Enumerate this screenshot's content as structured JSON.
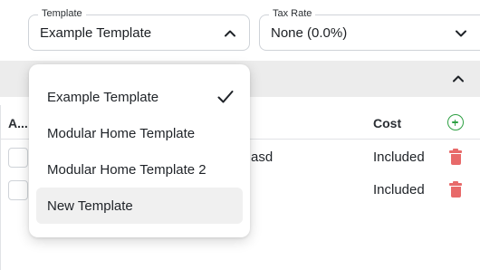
{
  "filters": {
    "template": {
      "label": "Template",
      "value": "Example Template",
      "icon": "chevron-up-icon"
    },
    "tax_rate": {
      "label": "Tax Rate",
      "value": "None (0.0%)",
      "icon": "chevron-down-icon"
    }
  },
  "section": {
    "icon": "chevron-up-icon"
  },
  "table": {
    "columns": {
      "a": "A...",
      "cost": "Cost"
    },
    "add_icon": "plus-circle-icon",
    "rows": [
      {
        "description": "asd",
        "cost": "Included"
      },
      {
        "description": "",
        "cost": "Included"
      }
    ]
  },
  "dropdown": {
    "items": [
      {
        "label": "Example Template",
        "selected": true
      },
      {
        "label": "Modular Home Template",
        "selected": false
      },
      {
        "label": "Modular Home Template 2",
        "selected": false
      },
      {
        "label": "New Template",
        "selected": false,
        "hovered": true
      }
    ]
  },
  "colors": {
    "add": "#2ea043",
    "delete": "#e86a6a",
    "section_bg": "#ececec"
  }
}
